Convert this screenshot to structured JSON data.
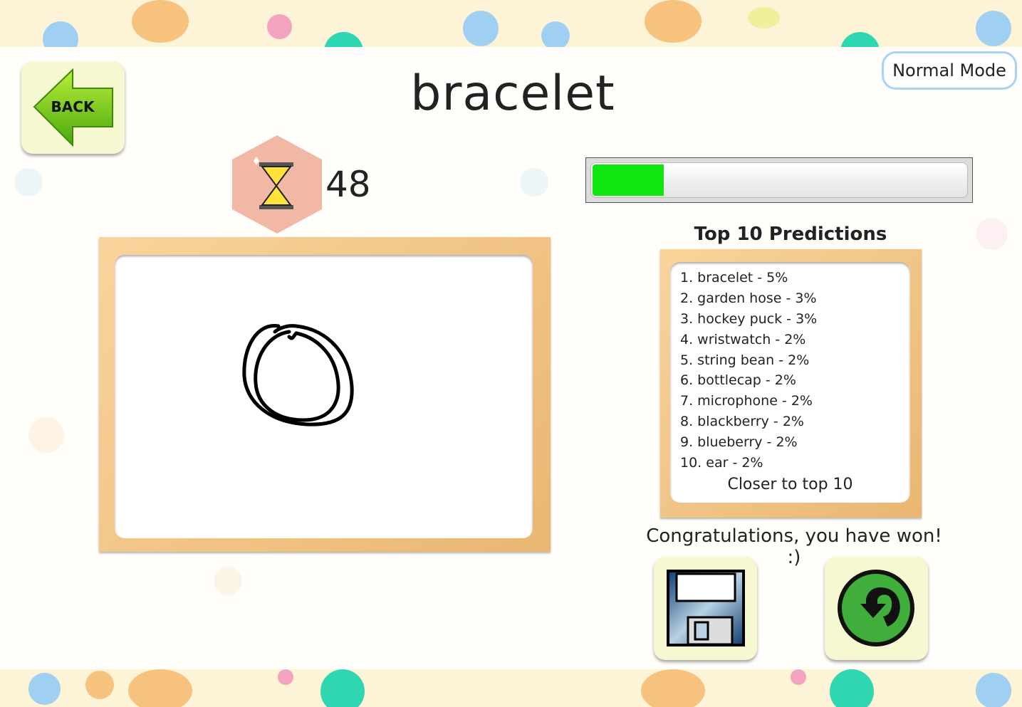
{
  "header": {
    "back_label": "BACK",
    "word": "bracelet",
    "mode": "Normal Mode"
  },
  "timer": {
    "seconds_left": "48",
    "icon": "hourglass-icon"
  },
  "progress": {
    "fraction": 0.19,
    "color": "#11e611"
  },
  "predictions": {
    "title": "Top 10 Predictions",
    "items": [
      "1. bracelet - 5%",
      "2. garden hose - 3%",
      "3. hockey puck - 3%",
      "4. wristwatch - 2%",
      "5. string bean - 2%",
      "6. bottlecap - 2%",
      "7. microphone - 2%",
      "8. blackberry - 2%",
      "9. blueberry - 2%",
      "10. ear - 2%"
    ],
    "footer": "Closer to top 10"
  },
  "result": {
    "message": "Congratulations, you have won! :)"
  },
  "actions": {
    "save_icon": "floppy-disk-icon",
    "replay_icon": "replay-arrow-icon"
  },
  "colors": {
    "button_bg": "#f6f8d2",
    "frame_wood": "#eab672",
    "timer_hex": "#f2b8a6",
    "mode_border": "#a9d3f5"
  }
}
